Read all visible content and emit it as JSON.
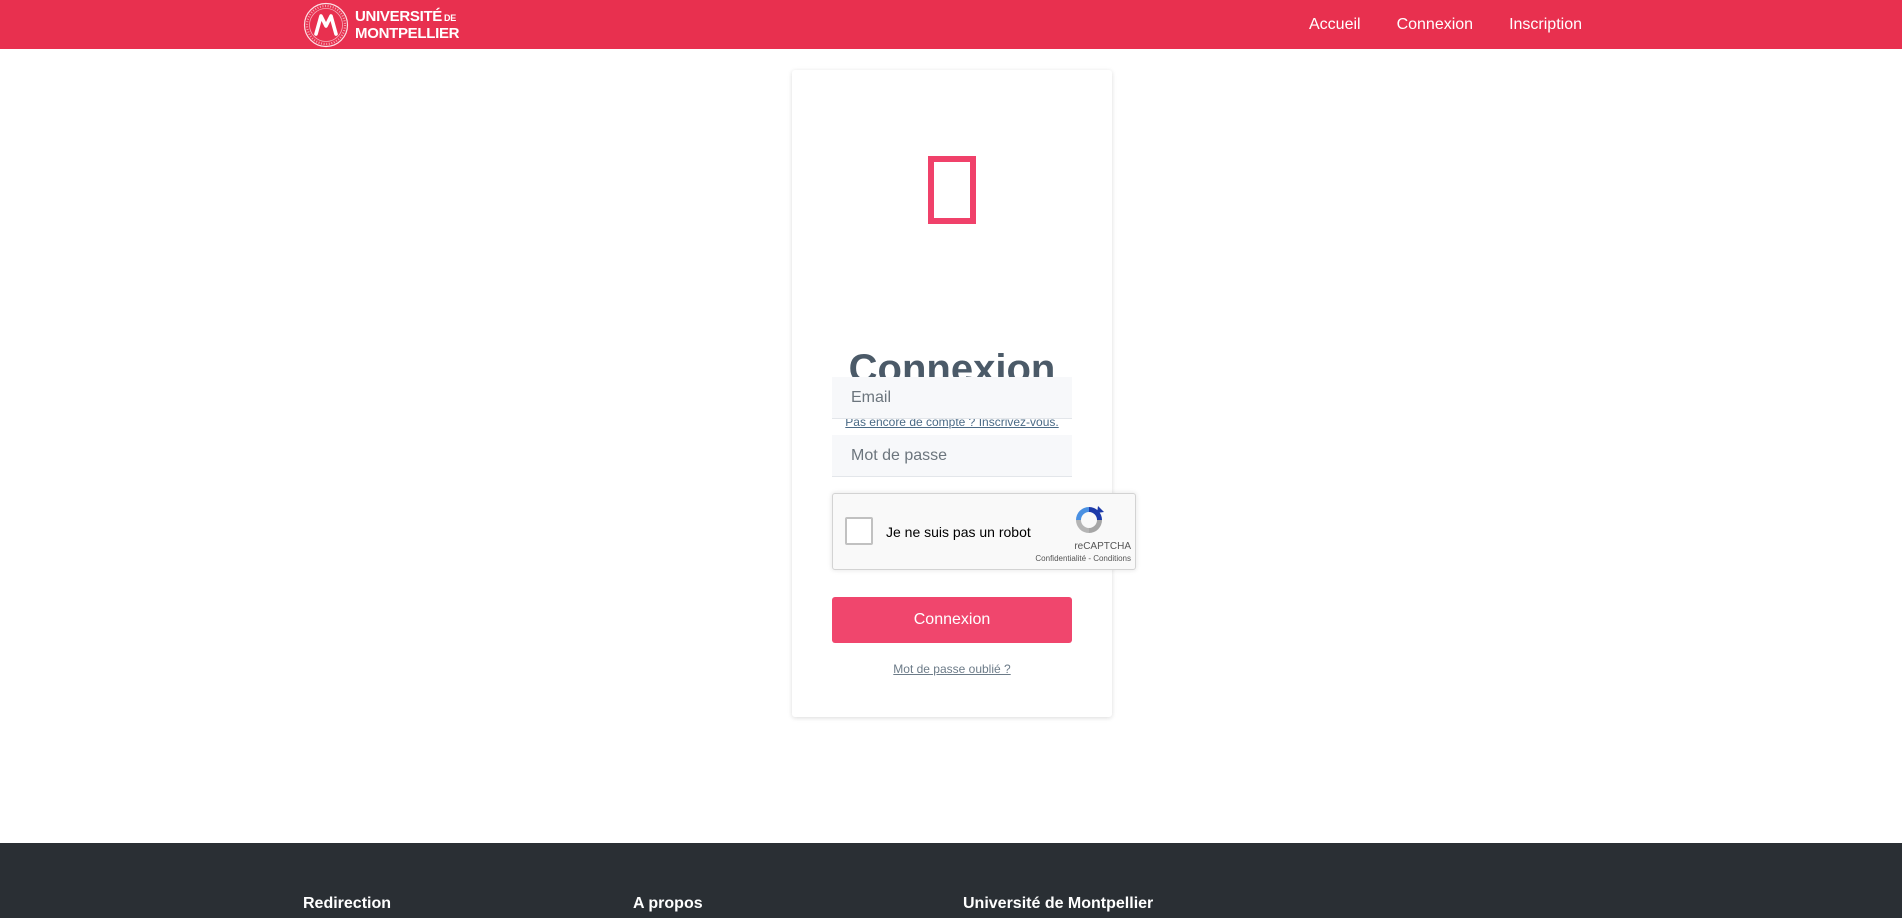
{
  "navbar": {
    "logo": {
      "line1": "UNIVERSITÉ",
      "line1_small": "DE",
      "line2": "MONTPELLIER"
    },
    "links": [
      "Accueil",
      "Connexion",
      "Inscription"
    ],
    "background_color": "#e8304f"
  },
  "login": {
    "icon": "user-icon",
    "title": "Connexion",
    "signup_link": "Pas encore de compte ? Inscrivez-vous.",
    "email_placeholder": "Email",
    "password_placeholder": "Mot de passe",
    "recaptcha": {
      "label": "Je ne suis pas un robot",
      "brand": "reCAPTCHA",
      "terms": "Confidentialité - Conditions"
    },
    "submit_label": "Connexion",
    "forgot_link": "Mot de passe oublié ?",
    "accent_color": "#f0466d"
  },
  "footer": {
    "headings": [
      "Redirection",
      "A propos",
      "Université de Montpellier"
    ],
    "background_color": "#2a2f34"
  }
}
